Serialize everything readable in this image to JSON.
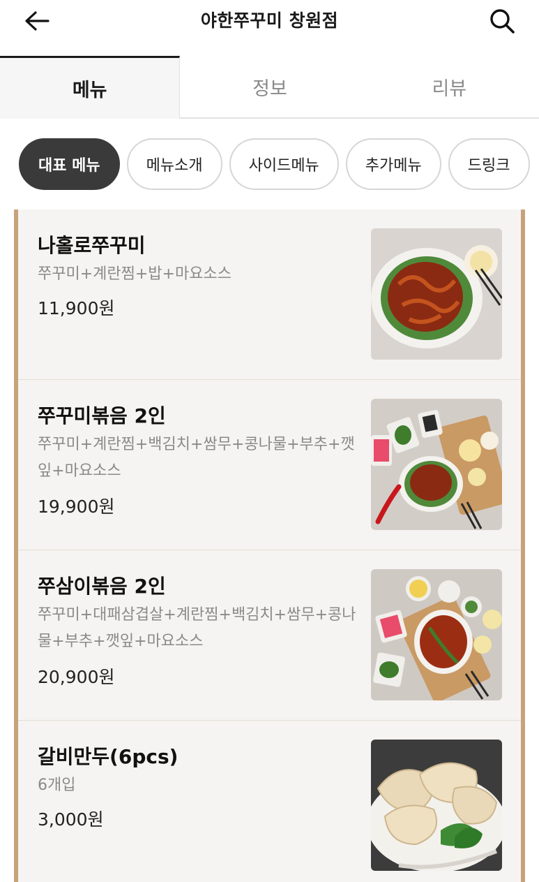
{
  "header": {
    "title": "야한쭈꾸미 창원점",
    "back_icon": "arrow-left-icon",
    "search_icon": "search-icon"
  },
  "tabs": [
    {
      "label": "메뉴",
      "active": true
    },
    {
      "label": "정보",
      "active": false
    },
    {
      "label": "리뷰",
      "active": false
    }
  ],
  "categories": [
    {
      "label": "대표 메뉴",
      "active": true
    },
    {
      "label": "메뉴소개",
      "active": false
    },
    {
      "label": "사이드메뉴",
      "active": false
    },
    {
      "label": "추가메뉴",
      "active": false
    },
    {
      "label": "드링크",
      "active": false
    }
  ],
  "menu_items": [
    {
      "name": "나홀로쭈꾸미",
      "description": "쭈꾸미+계란찜+밥+마요소스",
      "price": "11,900원"
    },
    {
      "name": "쭈꾸미볶음 2인",
      "description": "쭈꾸미+계란찜+백김치+쌈무+콩나물+부추+깻잎+마요소스",
      "price": "19,900원"
    },
    {
      "name": "쭈삼이볶음 2인",
      "description": "쭈꾸미+대패삼겹살+계란찜+백김치+쌈무+콩나물+부추+깻잎+마요소스",
      "price": "20,900원"
    },
    {
      "name": "갈비만두(6pcs)",
      "description": "6개입",
      "price": "3,000원"
    }
  ],
  "colors": {
    "accent_border": "#c7a27a",
    "active_chip": "#3a3a3a"
  }
}
